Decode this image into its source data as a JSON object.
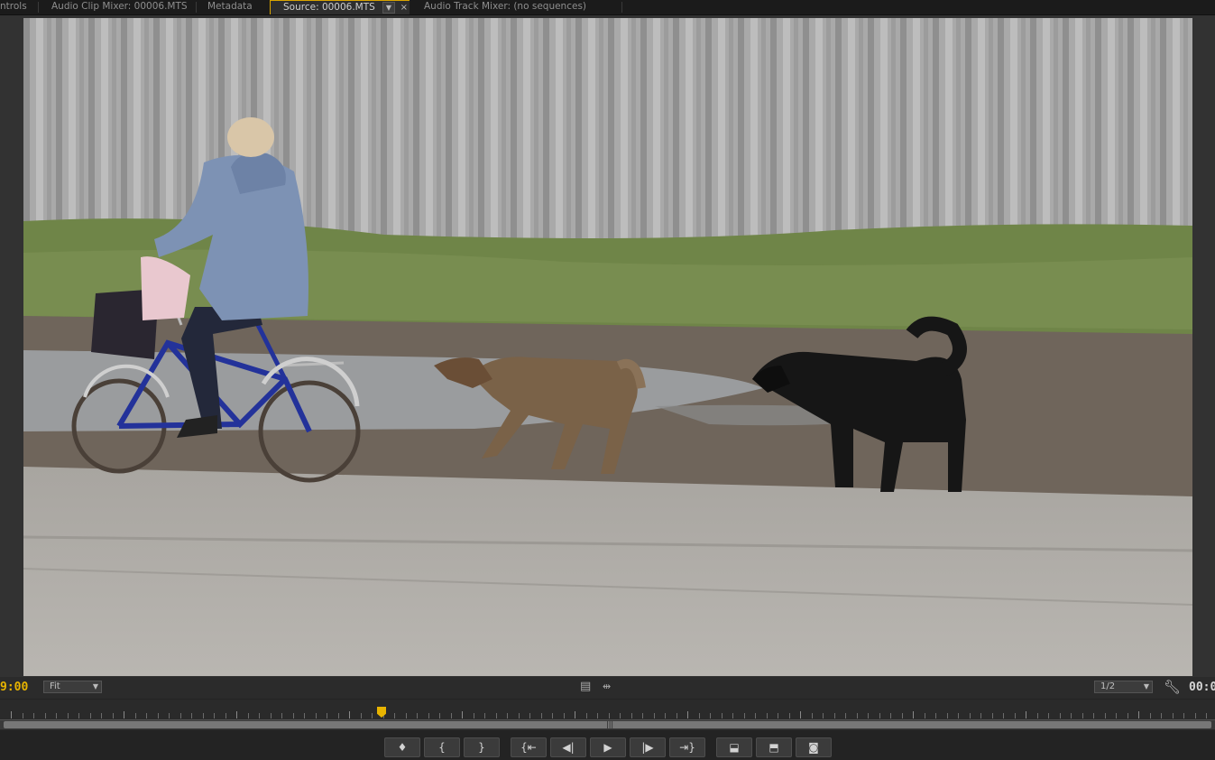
{
  "tabs": [
    {
      "label": "ntrols"
    },
    {
      "label": "Audio Clip Mixer: 00006.MTS"
    },
    {
      "label": "Metadata"
    },
    {
      "label": "Source: 00006.MTS",
      "active": true
    },
    {
      "label": "Audio Track Mixer: (no sequences)"
    }
  ],
  "monitor": {
    "timecode_left": "9:00",
    "timecode_right": "00:0",
    "zoom_label": "Fit",
    "resolution_label": "1/2"
  },
  "icons": {
    "tab_menu": "dropdown-arrow-icon",
    "tab_close": "close-icon",
    "drag_video": "film-strip-icon",
    "drag_audio": "audio-waveform-icon",
    "settings": "wrench-icon"
  },
  "transport": {
    "buttons": [
      {
        "name": "add-marker-button",
        "glyph": "♦"
      },
      {
        "name": "mark-in-button",
        "glyph": "{"
      },
      {
        "name": "mark-out-button",
        "glyph": "}"
      },
      {
        "name": "go-to-in-button",
        "glyph": "{⇤"
      },
      {
        "name": "step-back-button",
        "glyph": "◀|"
      },
      {
        "name": "play-stop-button",
        "glyph": "▶"
      },
      {
        "name": "step-forward-button",
        "glyph": "|▶"
      },
      {
        "name": "go-to-out-button",
        "glyph": "⇥}"
      },
      {
        "name": "insert-button",
        "glyph": "⬓"
      },
      {
        "name": "overwrite-button",
        "glyph": "⬒"
      },
      {
        "name": "export-frame-button",
        "glyph": "◙"
      }
    ]
  },
  "colors": {
    "accent": "#e8b400",
    "panel_bg": "#323232",
    "tab_bg": "#1b1b1b"
  }
}
